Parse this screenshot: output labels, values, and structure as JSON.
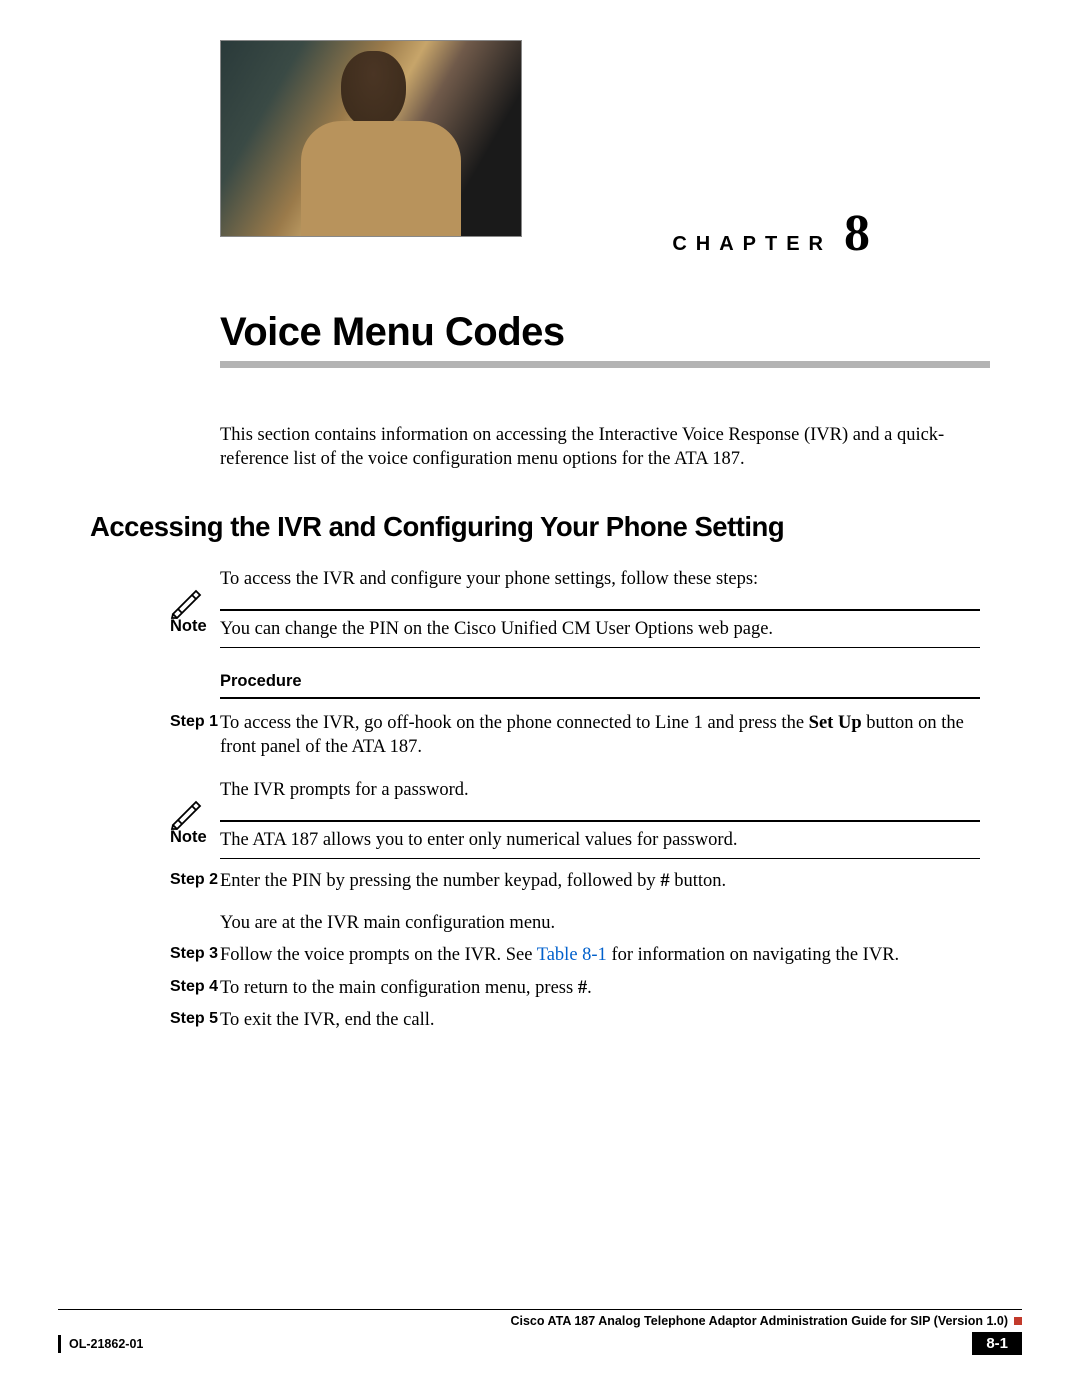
{
  "chapter": {
    "label": "CHAPTER",
    "number": "8",
    "title": "Voice Menu Codes"
  },
  "intro": "This section contains information on accessing the Interactive Voice Response (IVR) and a quick-reference list of the voice configuration menu options for the ATA 187.",
  "section1": {
    "heading": "Accessing the IVR and Configuring Your Phone Setting",
    "lead": "To access the IVR and configure your phone settings, follow these steps:"
  },
  "notes": {
    "label": "Note",
    "n1": "You can change the PIN on the Cisco Unified CM User Options web page.",
    "n2": "The ATA 187 allows you to enter only numerical values for password."
  },
  "procedure": {
    "label": "Procedure",
    "steps": [
      {
        "label": "Step 1",
        "pre": "To access the IVR, go off-hook on the phone connected to Line 1 and press the ",
        "bold": "Set Up",
        "post": " button on the front panel of the ATA 187.",
        "extra": "The IVR prompts for a password."
      },
      {
        "label": "Step 2",
        "pre": "Enter the PIN by pressing the number keypad, followed by ",
        "bold": "#",
        "post": " button.",
        "extra": "You are at the IVR main configuration menu."
      },
      {
        "label": "Step 3",
        "pre": "Follow the voice prompts on the IVR. See ",
        "link": "Table 8-1",
        "post": " for information on navigating the IVR."
      },
      {
        "label": "Step 4",
        "pre": "To return to the main configuration menu, press ",
        "bold": "#",
        "post": "."
      },
      {
        "label": "Step 5",
        "pre": "To exit the IVR, end the call."
      }
    ]
  },
  "footer": {
    "doc_title": "Cisco ATA 187 Analog Telephone Adaptor Administration Guide for SIP (Version 1.0)",
    "ol": "OL-21862-01",
    "page": "8-1"
  }
}
